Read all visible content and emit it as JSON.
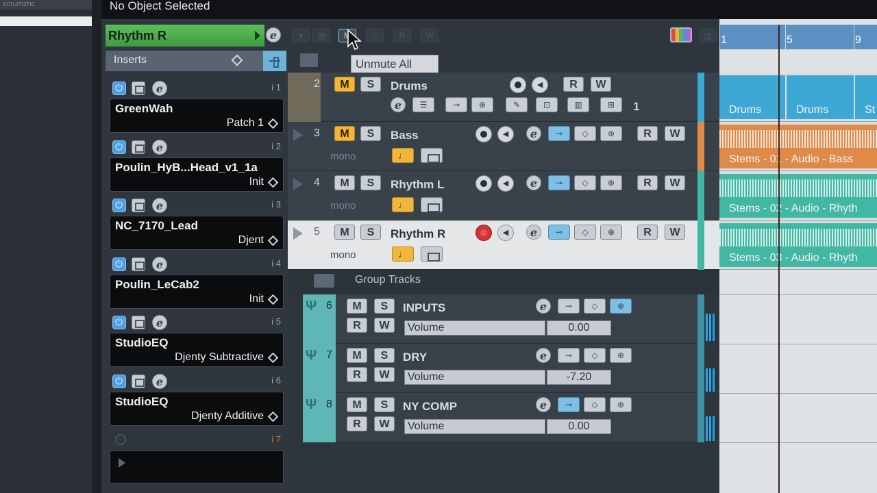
{
  "left_pane": {
    "top_text": "scrumznc"
  },
  "info_line": {
    "text": "No Object Selected"
  },
  "inspector": {
    "track_name": "Rhythm R",
    "inserts_label": "Inserts",
    "slots": [
      {
        "num": "i 1",
        "plugin": "GreenWah",
        "preset": "Patch 1"
      },
      {
        "num": "i 2",
        "plugin": "Poulin_HyB...Head_v1_1a",
        "preset": "Init"
      },
      {
        "num": "i 3",
        "plugin": "NC_7170_Lead",
        "preset": "Djent"
      },
      {
        "num": "i 4",
        "plugin": "Poulin_LeCab2",
        "preset": "Init"
      },
      {
        "num": "i 5",
        "plugin": "StudioEQ",
        "preset": "Djenty Subtractive"
      },
      {
        "num": "i 6",
        "plugin": "StudioEQ",
        "preset": "Djenty Additive"
      }
    ],
    "slot7_num": "i 7"
  },
  "toolbar": {
    "tooltip": "Unmute All",
    "buttons": [
      "M",
      "S",
      "R",
      "W"
    ]
  },
  "tracks": [
    {
      "num": "2",
      "name": "Drums",
      "sub": "",
      "count": "1"
    },
    {
      "num": "3",
      "name": "Bass",
      "sub": "mono"
    },
    {
      "num": "4",
      "name": "Rhythm L",
      "sub": "mono"
    },
    {
      "num": "5",
      "name": "Rhythm R",
      "sub": "mono"
    }
  ],
  "group_folder": {
    "name": "Group Tracks"
  },
  "group_tracks": [
    {
      "num": "6",
      "name": "INPUTS",
      "param": "Volume",
      "value": "0.00"
    },
    {
      "num": "7",
      "name": "DRY",
      "param": "Volume",
      "value": "-7.20"
    },
    {
      "num": "8",
      "name": "NY COMP",
      "param": "Volume",
      "value": "0.00"
    }
  ],
  "ruler": {
    "marks": [
      "1",
      "5",
      "9"
    ]
  },
  "events": {
    "drums_a": "Drums",
    "drums_b": "Drums",
    "drums_c": "St",
    "bass": "Stems - 01 - Audio - Bass",
    "rhythm_l": "Stems - 02 - Audio - Rhyth",
    "rhythm_r": "Stems - 03 - Audio - Rhyth"
  },
  "labels": {
    "mute": "M",
    "solo": "S",
    "read": "R",
    "write": "W"
  },
  "colors": {
    "selected_track_header": "#4caf50",
    "bass": "#e08a4a",
    "rhythm": "#41b7a4",
    "drums": "#3da7d6",
    "record_armed": "#d13434"
  }
}
